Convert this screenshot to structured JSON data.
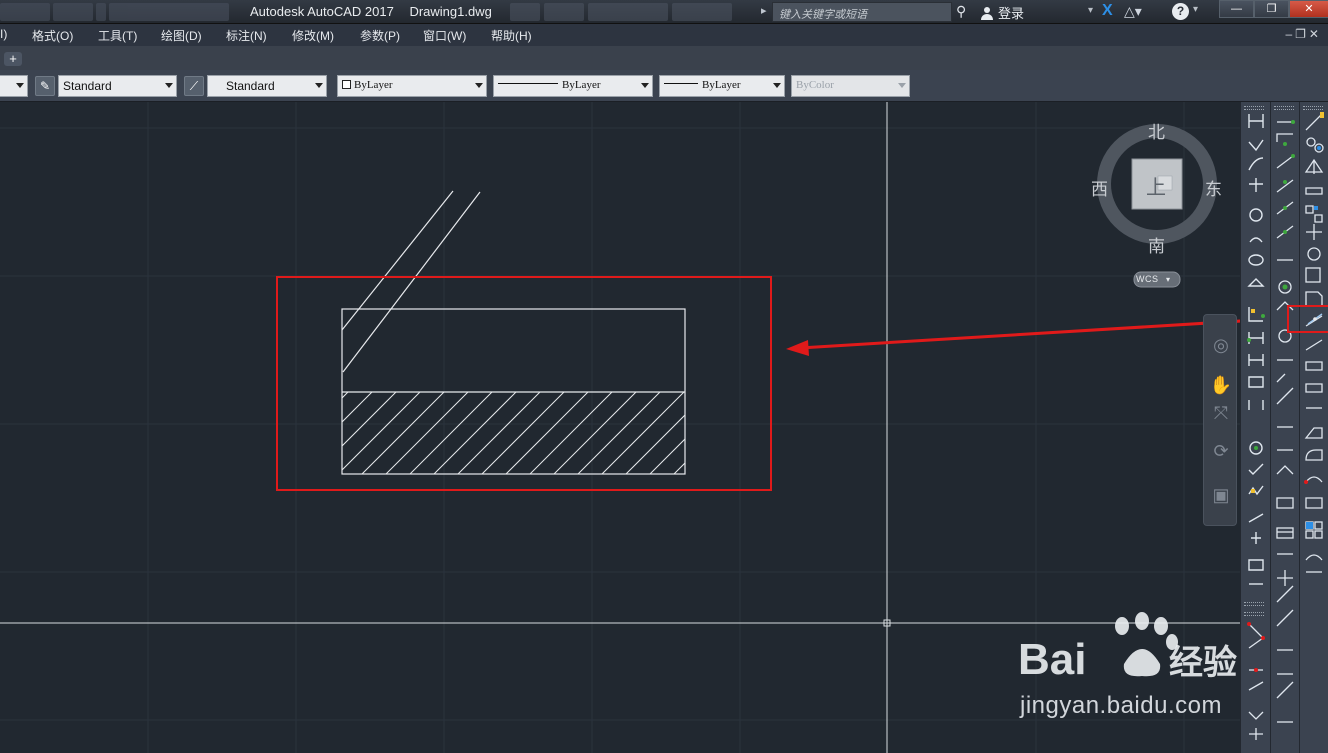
{
  "window": {
    "app_title": "Autodesk AutoCAD 2017",
    "file_name": "Drawing1.dwg",
    "search_placeholder": "键入关键字或短语",
    "login_label": "登录",
    "help_label": "?"
  },
  "menu": {
    "items": [
      {
        "label": "I)"
      },
      {
        "label": "格式(O)"
      },
      {
        "label": "工具(T)"
      },
      {
        "label": "绘图(D)"
      },
      {
        "label": "标注(N)"
      },
      {
        "label": "修改(M)"
      },
      {
        "label": "参数(P)"
      },
      {
        "label": "窗口(W)"
      },
      {
        "label": "帮助(H)"
      }
    ]
  },
  "tabs": {
    "new_tab_label": "+"
  },
  "properties_toolbar": {
    "text_style": "Standard",
    "dim_style": "Standard",
    "color": "ByLayer",
    "linetype": "ByLayer",
    "lineweight": "ByLayer",
    "plot_style": "ByColor"
  },
  "viewcube": {
    "north": "北",
    "south": "南",
    "east": "东",
    "west": "西",
    "face": "上",
    "ucs_label": "WCS"
  },
  "annotation": {
    "highlight_color": "#e01a1a",
    "callout_target": "construction-line-tool"
  },
  "watermark": {
    "brand": "Bai du 经验",
    "url": "jingyan.baidu.com"
  },
  "colors": {
    "canvas": "#212830",
    "drawing_lines": "#e8eaed",
    "toolbar": "#3b4350"
  }
}
